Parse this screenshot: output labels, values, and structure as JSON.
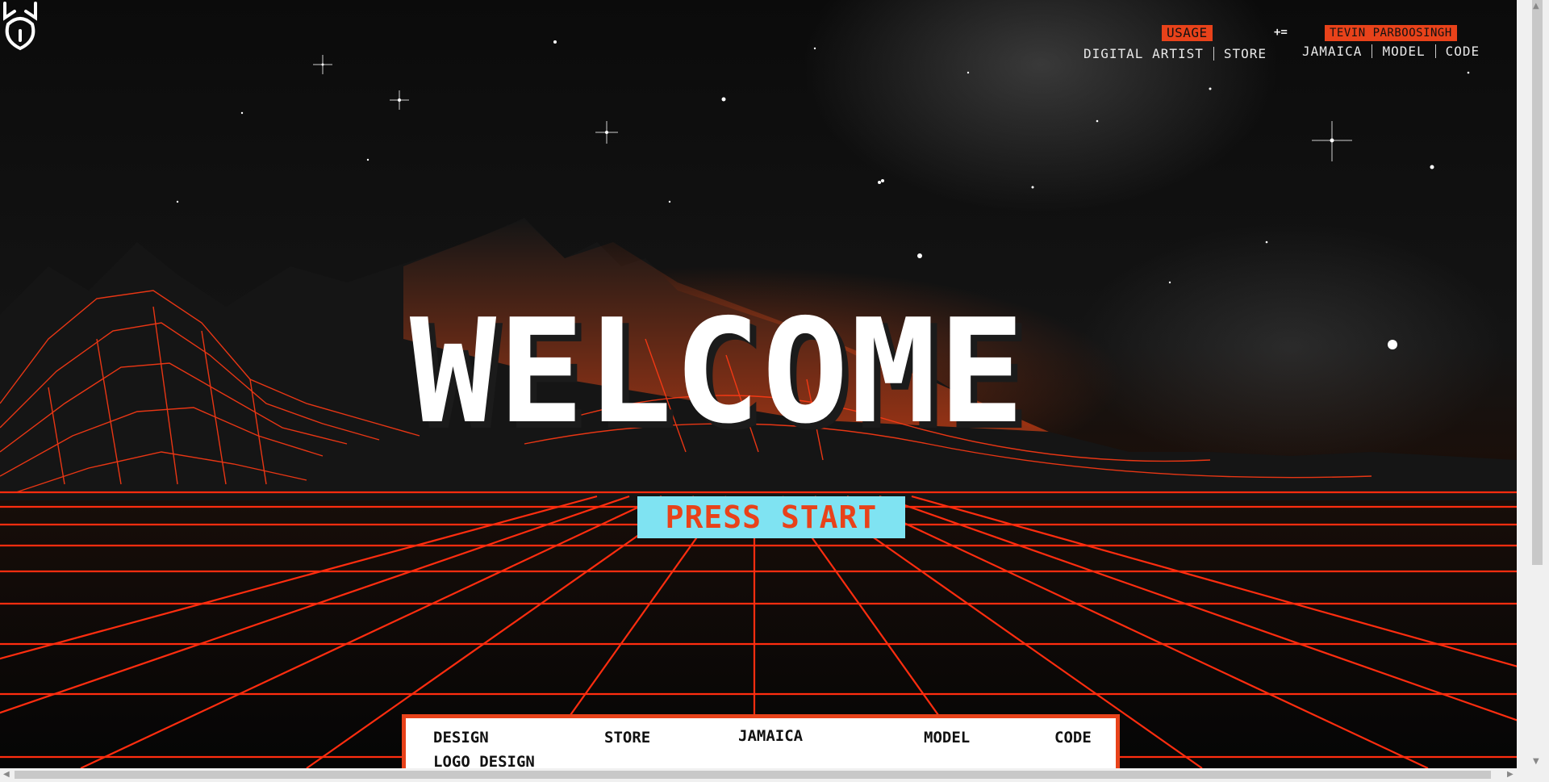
{
  "header": {
    "usage_label": "USAGE",
    "plus_equals": "+=",
    "name_label": "TEVIN PARBOOSINGH",
    "nav_left": [
      "DIGITAL ARTIST",
      "STORE"
    ],
    "nav_right": [
      "JAMAICA",
      "MODEL",
      "CODE"
    ]
  },
  "hero": {
    "title": "WELCOME",
    "cta": "PRESS START"
  },
  "panel": {
    "items": [
      "DESIGN",
      "STORE",
      "JAMAICA",
      "MODEL",
      "CODE"
    ],
    "sub_item": "LOGO DESIGN"
  },
  "icons": [
    "logo-icon"
  ],
  "colors": {
    "accent": "#e8421a",
    "cta_bg": "#7fe3f2",
    "grid": "#ff3a14",
    "text": "#ffffff"
  }
}
